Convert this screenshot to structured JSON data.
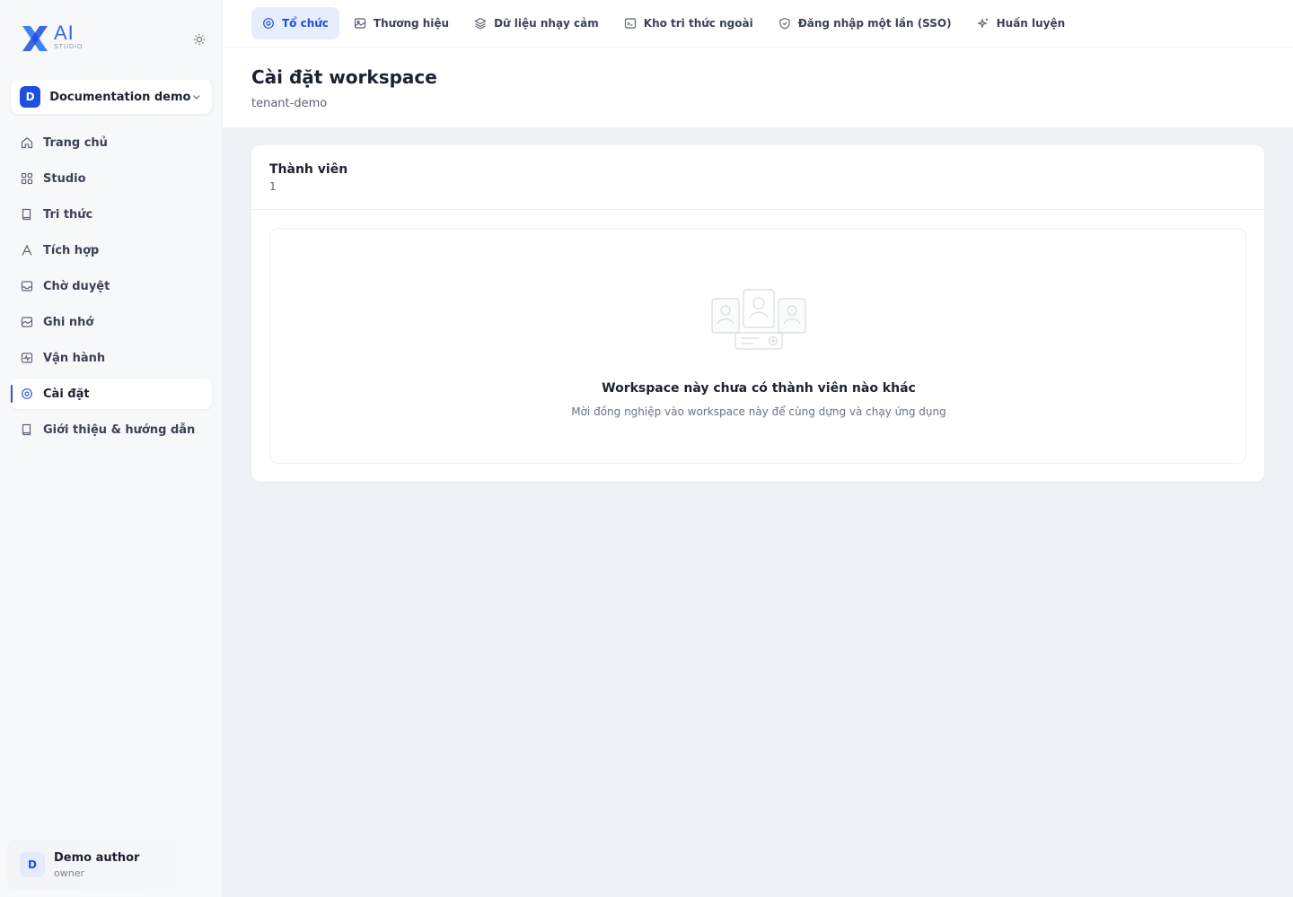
{
  "brand": {
    "logo_text": "AI",
    "logo_subtext": "STUDIO"
  },
  "workspace": {
    "avatar_letter": "D",
    "name": "Documentation demo"
  },
  "sidebar": {
    "items": [
      {
        "label": "Trang chủ",
        "icon": "home-icon"
      },
      {
        "label": "Studio",
        "icon": "grid-icon"
      },
      {
        "label": "Tri thức",
        "icon": "book-icon"
      },
      {
        "label": "Tích hợp",
        "icon": "tools-icon"
      },
      {
        "label": "Chờ duyệt",
        "icon": "inbox-icon"
      },
      {
        "label": "Ghi nhớ",
        "icon": "memo-icon"
      },
      {
        "label": "Vận hành",
        "icon": "activity-icon"
      },
      {
        "label": "Cài đặt",
        "icon": "settings-icon",
        "active": true
      },
      {
        "label": "Giới thiệu & hướng dẫn",
        "icon": "guide-book-icon"
      }
    ]
  },
  "user": {
    "avatar_letter": "D",
    "name": "Demo author",
    "role": "owner"
  },
  "tabs": [
    {
      "label": "Tổ chức",
      "icon": "settings-icon",
      "active": true
    },
    {
      "label": "Thương hiệu",
      "icon": "image-icon"
    },
    {
      "label": "Dữ liệu nhạy cảm",
      "icon": "layers-icon"
    },
    {
      "label": "Kho tri thức ngoài",
      "icon": "terminal-icon"
    },
    {
      "label": "Đăng nhập một lần (SSO)",
      "icon": "shield-icon"
    },
    {
      "label": "Huấn luyện",
      "icon": "sparkle-icon"
    }
  ],
  "page": {
    "title": "Cài đặt workspace",
    "subtitle": "tenant-demo"
  },
  "members": {
    "title": "Thành viên",
    "count": "1",
    "empty_title": "Workspace này chưa có thành viên nào khác",
    "empty_description": "Mời đồng nghiệp vào workspace này để cùng dựng và chạy ứng dụng"
  },
  "colors": {
    "accent": "#1f4fe0",
    "active_tab_bg": "#e8edfb",
    "page_bg": "#eff1f6"
  }
}
